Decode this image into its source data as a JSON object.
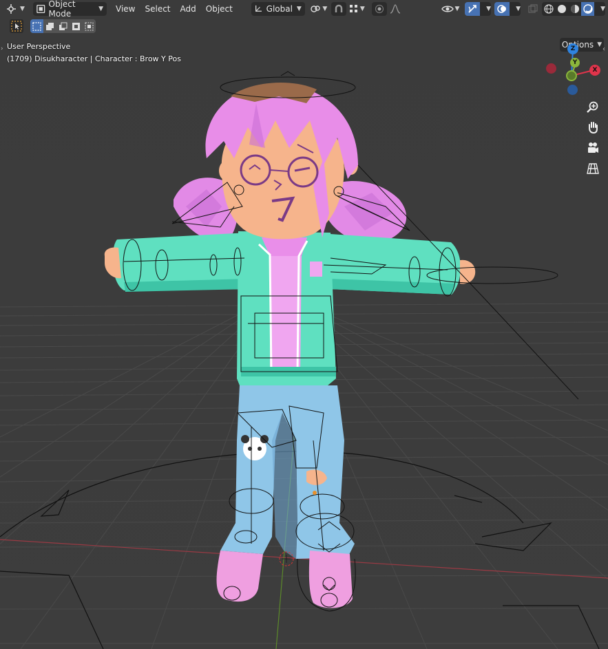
{
  "header": {
    "editor_type_icon": "camera-gizmo-icon",
    "mode_label": "Object Mode",
    "menus": [
      "View",
      "Select",
      "Add",
      "Object"
    ],
    "transform_orientation": "Global",
    "icons": [
      "transform-pivot-icon",
      "snap-icon",
      "snap-grid-icon",
      "proportional-edit-icon",
      "falloff-curve-icon",
      "visibility-icon",
      "gizmo-icon",
      "overlay-icon",
      "xray-icon",
      "wireframe-shading-icon",
      "solid-shading-icon",
      "material-shading-icon",
      "rendered-shading-icon"
    ]
  },
  "toolbar": {
    "options_label": "Options",
    "select_modes": [
      "select-new-icon",
      "select-extend-icon",
      "select-subtract-icon",
      "select-invert-icon",
      "select-intersect-icon"
    ]
  },
  "viewport": {
    "perspective_label": "User Perspective",
    "object_info": "(1709) Disukharacter | Character : Brow Y Pos"
  },
  "gizmo": {
    "z": "Z",
    "x": "X",
    "y": "Y",
    "colors": {
      "x": "#e0344b",
      "y": "#8bb63c",
      "z": "#2f84e0",
      "neg_x": "#9a2a3a",
      "neg_y": "#5a7a2a",
      "neg_z": "#2a5a9a"
    }
  },
  "nav": [
    "zoom-icon",
    "pan-hand-icon",
    "camera-view-icon",
    "orthographic-grid-icon"
  ],
  "colors": {
    "background": "#3a3a3a",
    "header_button": "#2b2b2b",
    "active_blue": "#4772b3",
    "hair": "#e88de8",
    "jacket": "#5fe0c0",
    "jeans": "#8fc6e8",
    "skin": "#f6b48c",
    "shoes": "#ef9fe0"
  }
}
